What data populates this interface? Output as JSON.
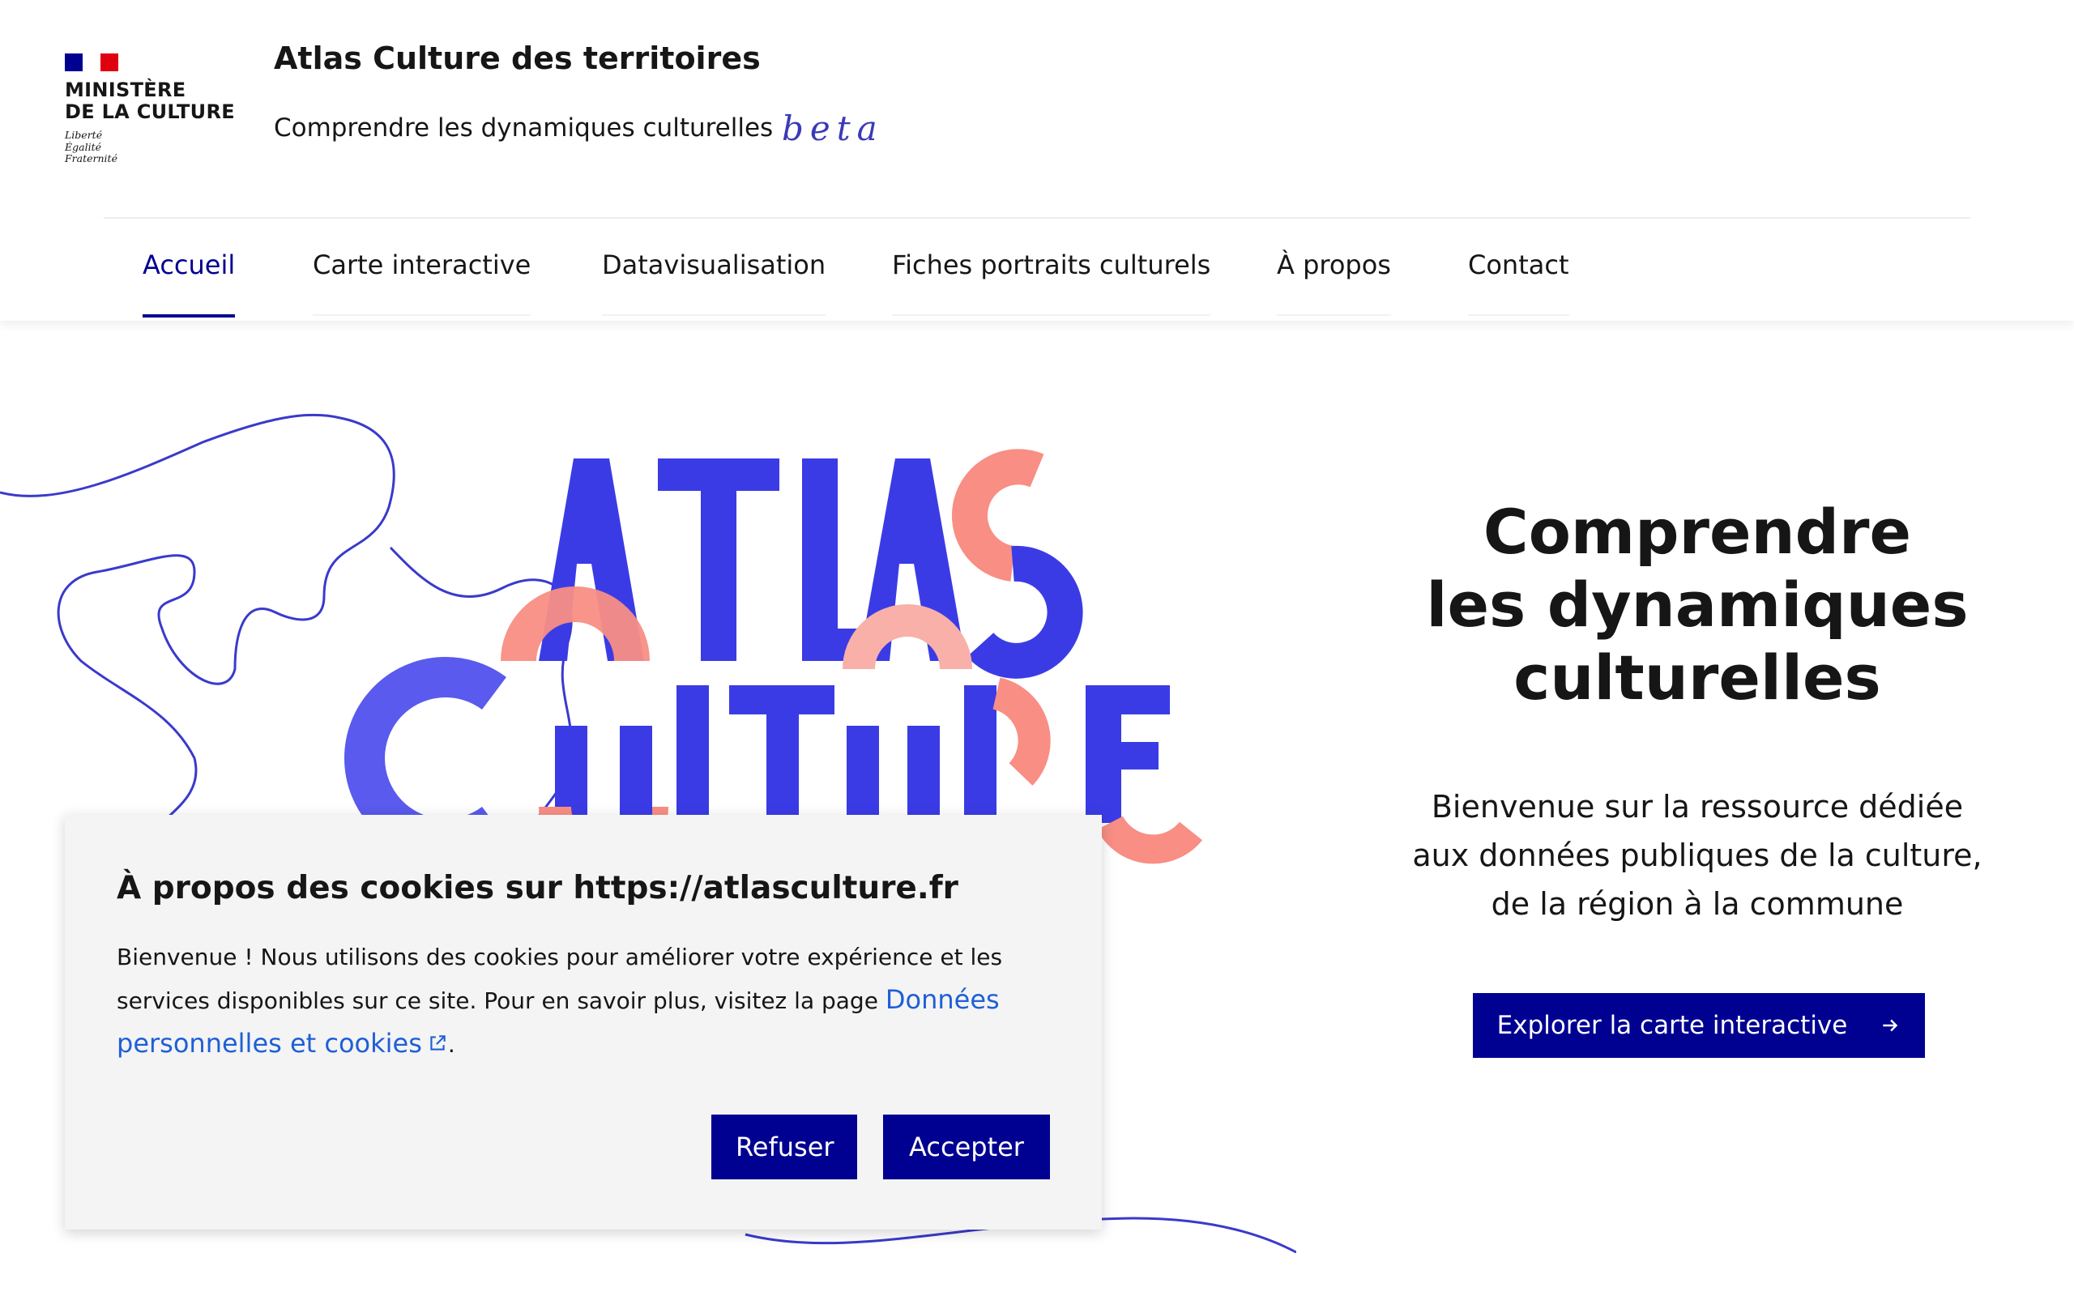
{
  "header": {
    "ministry_line1": "MINISTÈRE",
    "ministry_line2": "DE LA CULTURE",
    "motto": [
      "Liberté",
      "Égalité",
      "Fraternité"
    ],
    "site_title": "Atlas Culture des territoires",
    "tagline": "Comprendre les dynamiques culturelles",
    "beta": "beta"
  },
  "nav": {
    "items": [
      {
        "label": "Accueil",
        "active": true
      },
      {
        "label": "Carte interactive",
        "active": false
      },
      {
        "label": "Datavisualisation",
        "active": false
      },
      {
        "label": "Fiches portraits culturels",
        "active": false
      },
      {
        "label": "À propos",
        "active": false
      },
      {
        "label": "Contact",
        "active": false
      }
    ]
  },
  "hero": {
    "title_line1": "Comprendre",
    "title_line2": "les dynamiques",
    "title_line3": "culturelles",
    "subtitle_line1": "Bienvenue sur la ressource dédiée",
    "subtitle_line2": "aux données publiques de la culture,",
    "subtitle_line3": "de la région à la commune",
    "cta_label": "Explorer la carte interactive",
    "cta_icon": "arrow-right-icon",
    "logo_word1": "ATLAS",
    "logo_word2": "CULTURE"
  },
  "cookie": {
    "title": "À propos des cookies sur https://atlasculture.fr",
    "text_line1": "Bienvenue ! Nous utilisons des cookies pour améliorer votre expérience et les",
    "text_line2": "services disponibles sur ce site. Pour en savoir plus, visitez la page",
    "link_label_part1": "Données",
    "link_label_part2": "personnelles et cookies",
    "link_icon": "external-link-icon",
    "trailing": ".",
    "refuse_label": "Refuser",
    "accept_label": "Accepter"
  },
  "colors": {
    "primary": "#000091",
    "logo_blue": "#3b3be6",
    "logo_salmon": "#f88e84",
    "line_blue": "#3a3acc",
    "link": "#1f5fd6"
  }
}
